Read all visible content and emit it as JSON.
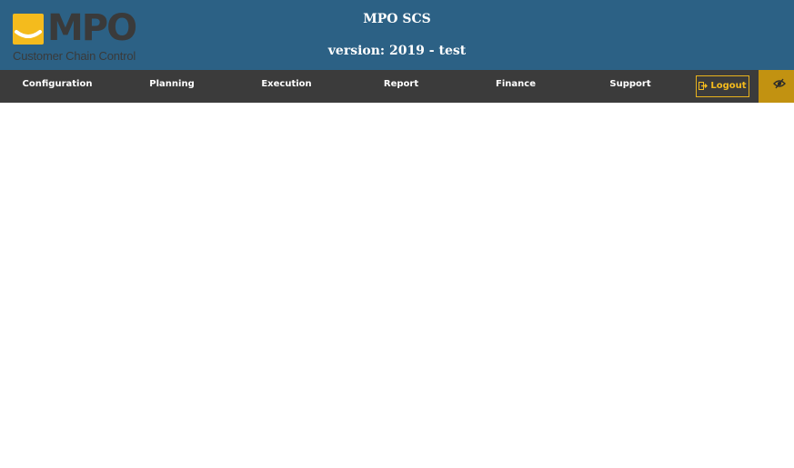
{
  "header": {
    "logo": {
      "letters": "MPO",
      "tagline": "Customer Chain Control"
    },
    "title": "MPO SCS",
    "version": "version: 2019 - test"
  },
  "nav": {
    "items": [
      {
        "label": "Configuration"
      },
      {
        "label": "Planning"
      },
      {
        "label": "Execution"
      },
      {
        "label": "Report"
      },
      {
        "label": "Finance"
      },
      {
        "label": "Support"
      }
    ],
    "logout_label": "Logout",
    "logout_icon": "sign-out-icon",
    "toggle_icon": "eye-slash-icon"
  },
  "colors": {
    "header_bg": "#2c6185",
    "nav_bg": "#3b3b3b",
    "accent": "#f4bb1d",
    "toggle_bg": "#c29211"
  }
}
